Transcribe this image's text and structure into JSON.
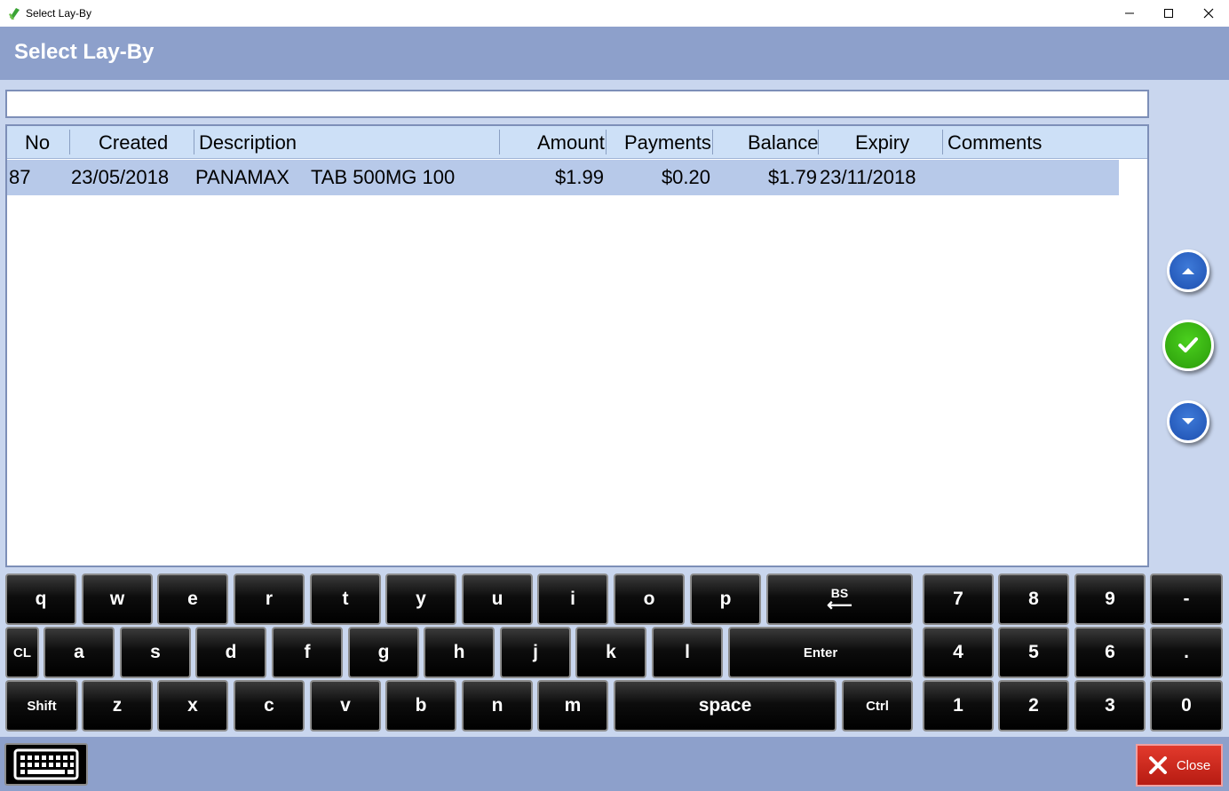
{
  "window": {
    "title": "Select Lay-By"
  },
  "header": {
    "title": "Select Lay-By"
  },
  "search": {
    "value": "",
    "placeholder": ""
  },
  "grid": {
    "columns": [
      "No",
      "Created",
      "Description",
      "Amount",
      "Payments",
      "Balance",
      "Expiry",
      "Comments"
    ],
    "rows": [
      {
        "no": "87",
        "created": "23/05/2018",
        "description": "PANAMAX    TAB 500MG 100",
        "amount": "$1.99",
        "payments": "$0.20",
        "balance": "$1.79",
        "expiry": "23/11/2018",
        "comments": ""
      }
    ],
    "selected_row": 0
  },
  "nav": {
    "up_icon": "chevron-up-icon",
    "confirm_icon": "check-icon",
    "down_icon": "chevron-down-icon"
  },
  "keyboard": {
    "row1": [
      "q",
      "w",
      "e",
      "r",
      "t",
      "y",
      "u",
      "i",
      "o",
      "p"
    ],
    "backspace": {
      "label": "BS",
      "arrow": "⟵"
    },
    "row2": [
      "a",
      "s",
      "d",
      "f",
      "g",
      "h",
      "j",
      "k",
      "l"
    ],
    "clear": "CL",
    "enter": "Enter",
    "row3": [
      "z",
      "x",
      "c",
      "v",
      "b",
      "n",
      "m"
    ],
    "shift": "Shift",
    "space": "space",
    "ctrl": "Ctrl",
    "numpad": [
      [
        "7",
        "8",
        "9",
        "-"
      ],
      [
        "4",
        "5",
        "6",
        "."
      ],
      [
        "1",
        "2",
        "3",
        "0"
      ]
    ]
  },
  "footer": {
    "close_label": "Close",
    "keyboard_icon": "keyboard-icon",
    "close_icon": "x-icon"
  },
  "colors": {
    "header": "#8da0cb",
    "selected_row": "#b7c9e9",
    "confirm": "#2a9a0a",
    "nav": "#1d4fb0",
    "close": "#c72418"
  }
}
